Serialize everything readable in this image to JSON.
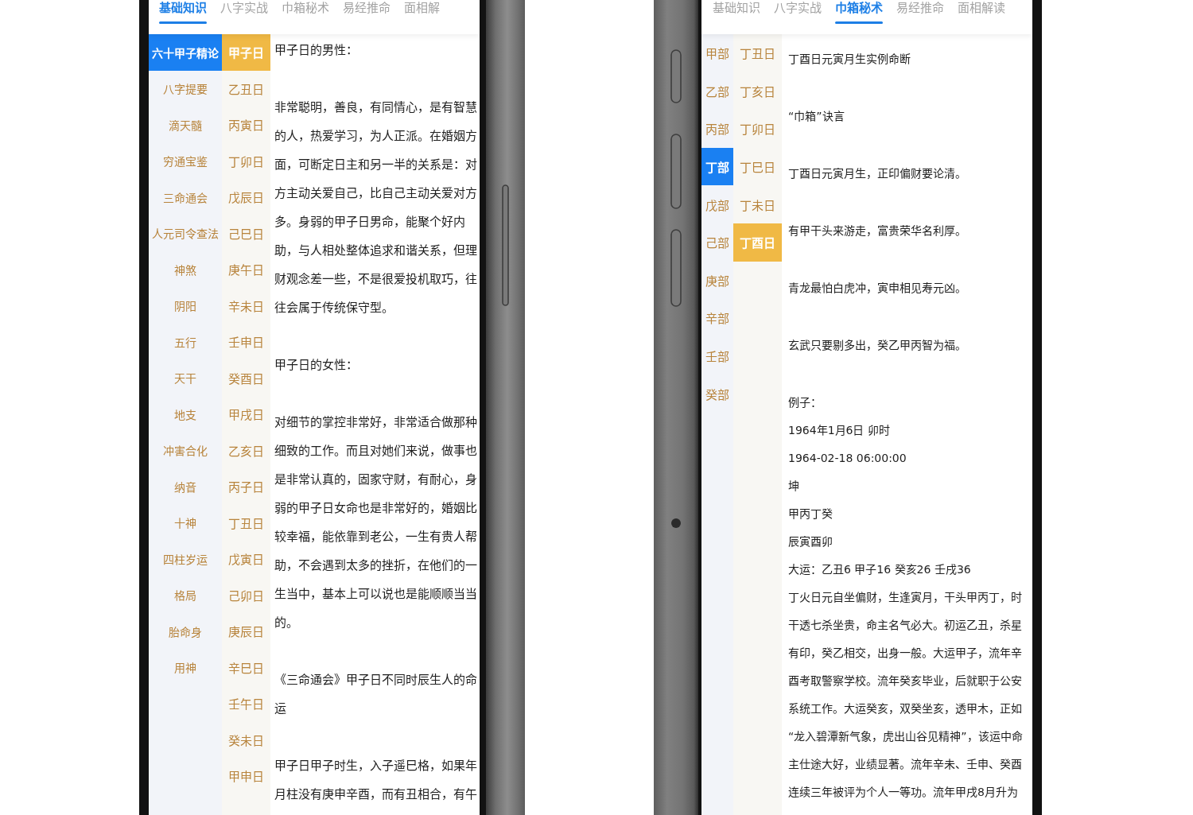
{
  "phones": [
    {
      "kind": "right",
      "tabs": [
        {
          "label": "基础知识",
          "selected": true
        },
        {
          "label": "八字实战",
          "selected": false
        },
        {
          "label": "巾箱秘术",
          "selected": false
        },
        {
          "label": "易经推命",
          "selected": false
        },
        {
          "label": "面相解",
          "selected": false
        }
      ],
      "categories": [
        {
          "label": "六十甲子精论",
          "selected": true
        },
        {
          "label": "八字提要",
          "selected": false
        },
        {
          "label": "滴天髓",
          "selected": false
        },
        {
          "label": "穷通宝鉴",
          "selected": false
        },
        {
          "label": "三命通会",
          "selected": false
        },
        {
          "label": "人元司令查法",
          "selected": false
        },
        {
          "label": "神煞",
          "selected": false
        },
        {
          "label": "阴阳",
          "selected": false
        },
        {
          "label": "五行",
          "selected": false
        },
        {
          "label": "天干",
          "selected": false
        },
        {
          "label": "地支",
          "selected": false
        },
        {
          "label": "冲害合化",
          "selected": false
        },
        {
          "label": "纳音",
          "selected": false
        },
        {
          "label": "十神",
          "selected": false
        },
        {
          "label": "四柱岁运",
          "selected": false
        },
        {
          "label": "格局",
          "selected": false
        },
        {
          "label": "胎命身",
          "selected": false
        },
        {
          "label": "用神",
          "selected": false
        }
      ],
      "days": [
        {
          "label": "甲子日",
          "selected": true
        },
        {
          "label": "乙丑日",
          "selected": false
        },
        {
          "label": "丙寅日",
          "selected": false
        },
        {
          "label": "丁卯日",
          "selected": false
        },
        {
          "label": "戊辰日",
          "selected": false
        },
        {
          "label": "己巳日",
          "selected": false
        },
        {
          "label": "庚午日",
          "selected": false
        },
        {
          "label": "辛未日",
          "selected": false
        },
        {
          "label": "壬申日",
          "selected": false
        },
        {
          "label": "癸酉日",
          "selected": false
        },
        {
          "label": "甲戌日",
          "selected": false
        },
        {
          "label": "乙亥日",
          "selected": false
        },
        {
          "label": "丙子日",
          "selected": false
        },
        {
          "label": "丁丑日",
          "selected": false
        },
        {
          "label": "戊寅日",
          "selected": false
        },
        {
          "label": "己卯日",
          "selected": false
        },
        {
          "label": "庚辰日",
          "selected": false
        },
        {
          "label": "辛巳日",
          "selected": false
        },
        {
          "label": "壬午日",
          "selected": false
        },
        {
          "label": "癸未日",
          "selected": false
        },
        {
          "label": "甲申日",
          "selected": false
        }
      ],
      "sections": [
        {
          "paragraphs": [
            "甲子日的男性："
          ]
        },
        {
          "paragraphs": [
            "非常聪明，善良，有同情心，是有智慧的人，热爱学习，为人正派。在婚姻方面，可断定日主和另一半的关系是：对方主动关爱自己，比自己主动关爱对方多。身弱的甲子日男命，能聚个好内助，与人相处整体追求和谐关系，但理财观念差一些，不是很爱投机取巧，往往会属于传统保守型。"
          ]
        },
        {
          "paragraphs": [
            "甲子日的女性："
          ]
        },
        {
          "paragraphs": [
            "对细节的掌控非常好，非常适合做那种细致的工作。而且对她们来说，做事也是非常认真的，固家守财，有耐心，身弱的甲子日女命也是非常好的，婚姻比较幸福，能依靠到老公，一生有贵人帮助，不会遇到太多的挫折，在他们的一生当中，基本上可以说也是能顺顺当当的。"
          ]
        },
        {
          "paragraphs": [
            "《三命通会》甲子日不同时辰生人的命运"
          ]
        },
        {
          "paragraphs": [
            "甲子日甲子时生，入子遥巳格，如果年月柱没有庚申辛酉，而有丑相合，有午"
          ]
        }
      ]
    },
    {
      "kind": "left",
      "tabs": [
        {
          "label": "基础知识",
          "selected": false
        },
        {
          "label": "八字实战",
          "selected": false
        },
        {
          "label": "巾箱秘术",
          "selected": true
        },
        {
          "label": "易经推命",
          "selected": false
        },
        {
          "label": "面相解读",
          "selected": false
        }
      ],
      "categories": [
        {
          "label": "甲部",
          "selected": false
        },
        {
          "label": "乙部",
          "selected": false
        },
        {
          "label": "丙部",
          "selected": false
        },
        {
          "label": "丁部",
          "selected": true
        },
        {
          "label": "戊部",
          "selected": false
        },
        {
          "label": "己部",
          "selected": false
        },
        {
          "label": "庚部",
          "selected": false
        },
        {
          "label": "辛部",
          "selected": false
        },
        {
          "label": "壬部",
          "selected": false
        },
        {
          "label": "癸部",
          "selected": false
        }
      ],
      "days": [
        {
          "label": "丁丑日",
          "selected": false
        },
        {
          "label": "丁亥日",
          "selected": false
        },
        {
          "label": "丁卯日",
          "selected": false
        },
        {
          "label": "丁巳日",
          "selected": false
        },
        {
          "label": "丁未日",
          "selected": false
        },
        {
          "label": "丁酉日",
          "selected": true
        }
      ],
      "sections": [
        {
          "paragraphs": [
            "丁酉日元寅月生实例命断"
          ]
        },
        {
          "paragraphs": [
            "“巾箱”诀言"
          ]
        },
        {
          "paragraphs": [
            "丁酉日元寅月生，正印偏财要论清。"
          ]
        },
        {
          "paragraphs": [
            "有甲干头来游走，富贵荣华名利厚。"
          ]
        },
        {
          "paragraphs": [
            "青龙最怕白虎冲，寅申相见寿元凶。"
          ]
        },
        {
          "paragraphs": [
            "玄武只要剔多出，癸乙甲丙智为福。"
          ]
        },
        {
          "paragraphs": [
            "例子：",
            "1964年1月6日 卯时",
            "1964-02-18 06:00:00",
            "坤",
            "甲丙丁癸",
            "辰寅酉卯",
            "大运：乙丑6 甲子16 癸亥26 壬戌36",
            "丁火日元自坐偏财，生逢寅月，干头甲丙丁，时干透七杀坐贵，命主名气必大。初运乙丑，杀星有印，癸乙相交，出身一般。大运甲子，流年辛酉考取警察学校。流年癸亥毕业，后就职于公安系统工作。大运癸亥，双癸坐亥，透甲木，正如“龙入碧潭新气象，虎出山谷见精神”，该运中命主仕途大好，业绩显著。流年辛未、壬申、癸酉连续三年被评为个人一等功。流年甲戌8月升为"
          ]
        }
      ]
    }
  ]
}
